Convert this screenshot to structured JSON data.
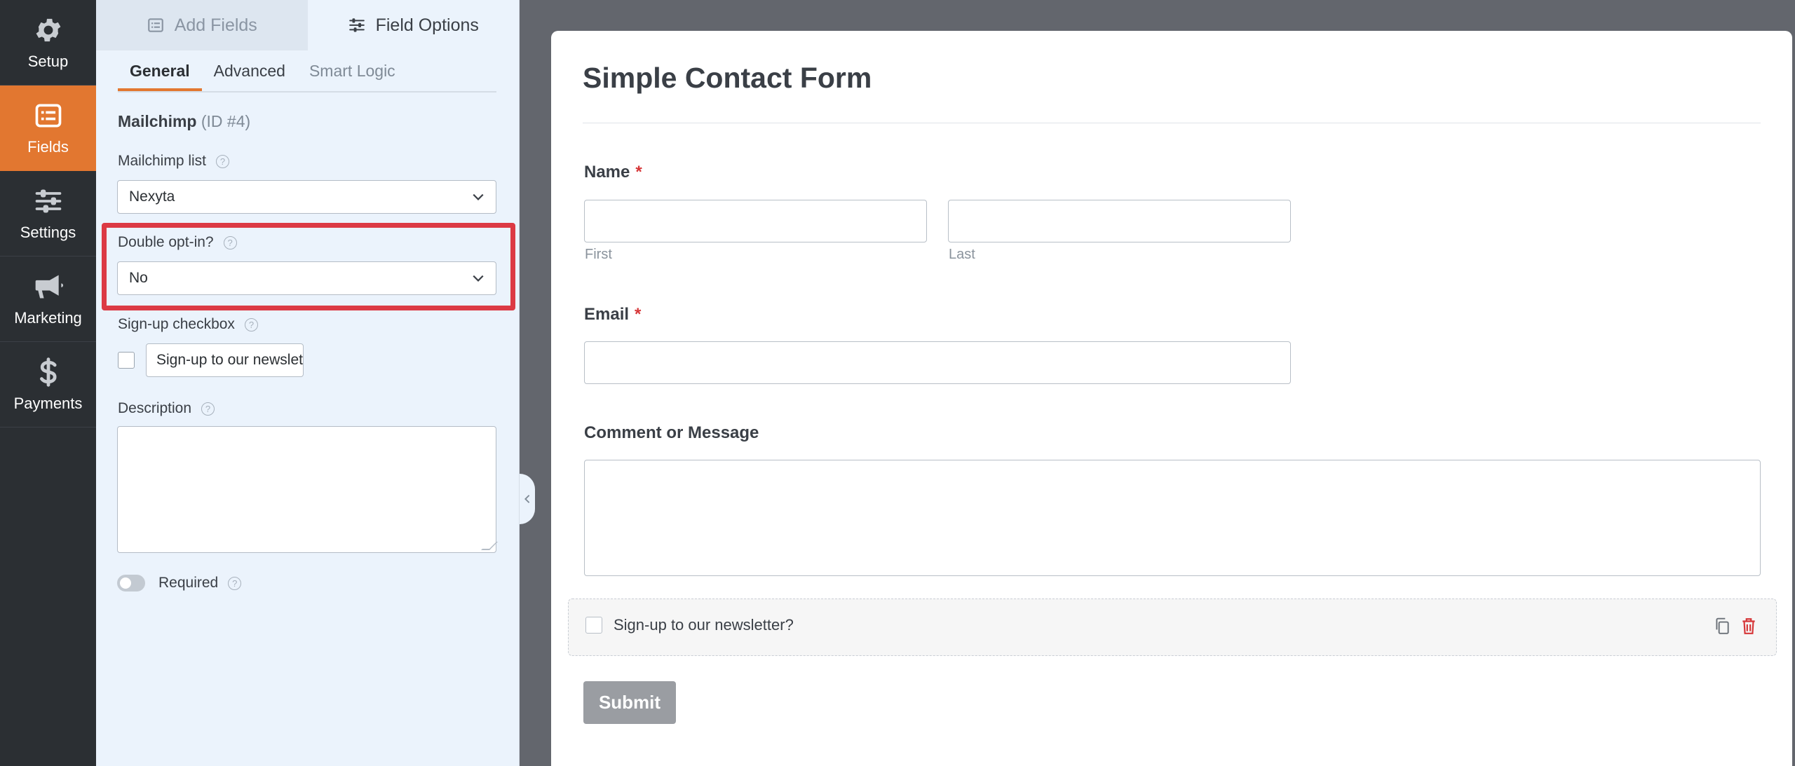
{
  "nav": {
    "items": [
      {
        "label": "Setup",
        "icon": "gear-icon"
      },
      {
        "label": "Fields",
        "icon": "list-icon"
      },
      {
        "label": "Settings",
        "icon": "sliders-icon"
      },
      {
        "label": "Marketing",
        "icon": "megaphone-icon"
      },
      {
        "label": "Payments",
        "icon": "dollar-icon"
      }
    ],
    "active": "Fields",
    "active_color": "#e27730"
  },
  "panel": {
    "tabs": [
      {
        "label": "Add Fields",
        "icon": "list-icon"
      },
      {
        "label": "Field Options",
        "icon": "sliders-icon"
      }
    ],
    "subtabs": [
      "General",
      "Advanced",
      "Smart Logic"
    ],
    "field": {
      "name": "Mailchimp",
      "id": "(ID #4)"
    },
    "mailchimp_list": {
      "label": "Mailchimp list",
      "value": "Nexyta"
    },
    "double_optin": {
      "label": "Double opt-in?",
      "value": "No"
    },
    "signup_checkbox": {
      "label": "Sign-up checkbox",
      "value": "Sign-up to our newsletter?",
      "visible_text": "Sign-up to our newslette"
    },
    "description": {
      "label": "Description"
    },
    "required": {
      "label": "Required"
    },
    "help_glyph": "?",
    "highlight_color": "#dc3a44"
  },
  "form": {
    "title": "Simple Contact Form",
    "name": {
      "label": "Name",
      "required": "*",
      "first": "First",
      "last": "Last"
    },
    "email": {
      "label": "Email",
      "required": "*"
    },
    "comment": {
      "label": "Comment or Message"
    },
    "signup": {
      "text": "Sign-up to our newsletter?"
    },
    "submit": "Submit"
  }
}
